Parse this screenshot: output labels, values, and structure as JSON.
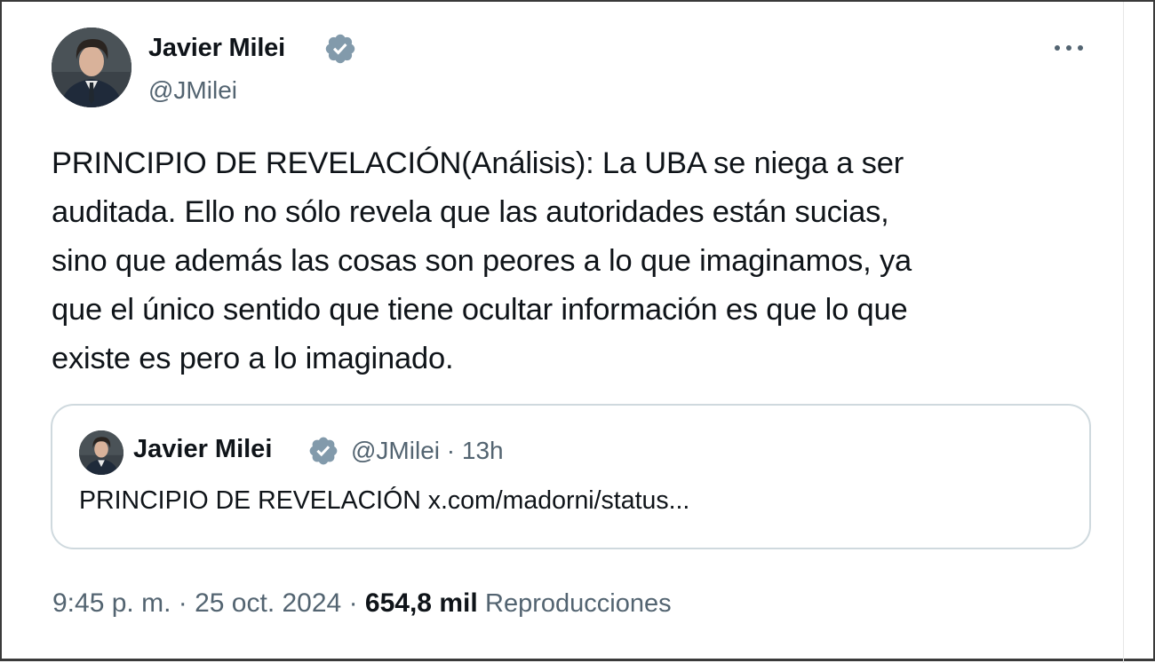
{
  "tweet": {
    "author": {
      "name": "Javier Milei",
      "handle": "@JMilei",
      "verified_color": "#829aab"
    },
    "more_icon": "more-horizontal-icon",
    "text_lines": [
      "PRINCIPIO DE REVELACIÓN(Análisis): La UBA se niega a ser",
      "auditada. Ello no sólo revela que las autoridades están sucias,",
      "sino que además las cosas son peores a lo que imaginamos, ya",
      "que el único sentido que tiene ocultar información es que lo que",
      "existe es pero a lo imaginado."
    ],
    "quoted": {
      "name": "Javier Milei",
      "handle": "@JMilei",
      "separator": "·",
      "time": "13h",
      "text": "PRINCIPIO DE REVELACIÓN x.com/madorni/status..."
    },
    "meta": {
      "time": "9:45 p. m.",
      "separator": "·",
      "date": "25 oct. 2024",
      "views_count": "654,8 mil",
      "views_label": "Reproducciones"
    }
  },
  "colors": {
    "text_primary": "#0f1419",
    "text_secondary": "#536471",
    "border": "#cfd9de"
  }
}
